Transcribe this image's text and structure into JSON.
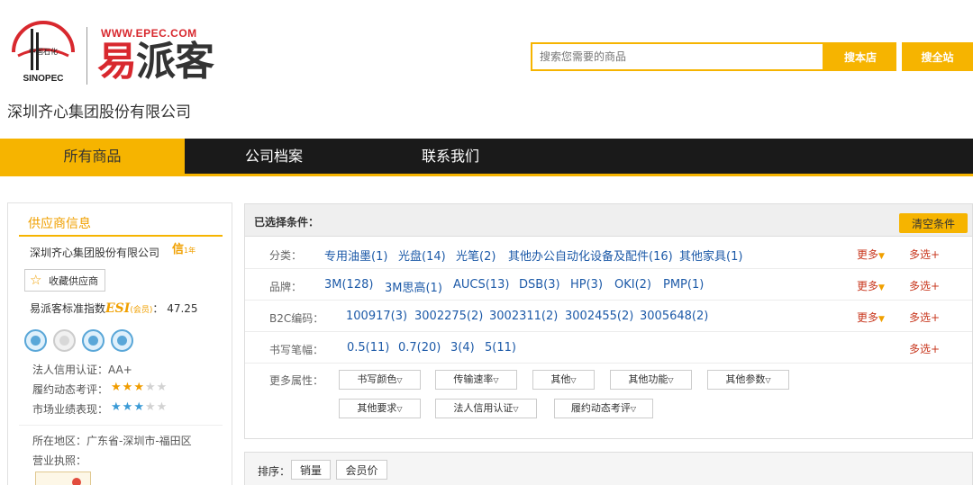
{
  "header": {
    "epec_url": "WWW.EPEC.COM",
    "epec_name_first": "易",
    "epec_name_rest": "派客",
    "company_title": "深圳齐心集团股份有限公司",
    "sinopec_label": "SINOPEC",
    "sinopec_cn": "中国石化"
  },
  "search": {
    "placeholder": "搜索您需要的商品",
    "store_label": "搜本店",
    "site_label": "搜全站"
  },
  "nav": {
    "items": [
      {
        "label": "所有商品",
        "active": true
      },
      {
        "label": "公司档案",
        "active": false
      },
      {
        "label": "联系我们",
        "active": false
      }
    ]
  },
  "sidebar": {
    "title": "供应商信息",
    "company": "深圳齐心集团股份有限公司",
    "xin_badge": "信",
    "xin_year": "1年",
    "favorite_label": "收藏供应商",
    "esi_prefix": "易派客标准指数",
    "esi_mark": "ESI",
    "esi_member": "(会员)",
    "esi_value": "： 47.25",
    "legal_credit_label": "法人信用认证：",
    "legal_credit_value": "AA+",
    "performance_label": "履约动态考评：",
    "performance_stars": 3,
    "market_label": "市场业绩表现：",
    "market_stars": 3,
    "region_label": "所在地区：",
    "region_value": "广东省-深圳市-福田区",
    "license_label": "营业执照："
  },
  "filter": {
    "header_label": "已选择条件：",
    "clear_label": "清空条件",
    "more_label": "更多",
    "multi_label": "多选+",
    "rows": [
      {
        "label": "分类：",
        "options": [
          "专用油墨(1)",
          "光盘(14)",
          "光笔(2)",
          "其他办公自动化设备及配件(16)",
          "其他家具(1)"
        ],
        "has_more": true
      },
      {
        "label": "品牌：",
        "options": [
          "3M(128)",
          "3M思高(1)",
          "AUCS(13)",
          "DSB(3)",
          "HP(3)",
          "OKI(2)",
          "PMP(1)"
        ],
        "has_more": true
      },
      {
        "label": "B2C编码：",
        "options": [
          "100917(3)",
          "3002275(2)",
          "3002311(2)",
          "3002455(2)",
          "3005648(2)"
        ],
        "has_more": true
      },
      {
        "label": "书写笔幅：",
        "options": [
          "0.5(11)",
          "0.7(20)",
          "3(4)",
          "5(11)"
        ],
        "has_more": false
      }
    ],
    "attr_label": "更多属性：",
    "attributes_row1": [
      "书写颜色",
      "传输速率",
      "其他",
      "其他功能",
      "其他参数"
    ],
    "attributes_row2": [
      "其他要求",
      "法人信用认证",
      "履约动态考评"
    ]
  },
  "sort": {
    "label": "排序：",
    "options": [
      "销量",
      "会员价"
    ]
  },
  "colors": {
    "accent": "#f6b400",
    "link": "#1d5aa8",
    "more_red": "#c8381f",
    "nav_bg": "#1a1a1a"
  }
}
